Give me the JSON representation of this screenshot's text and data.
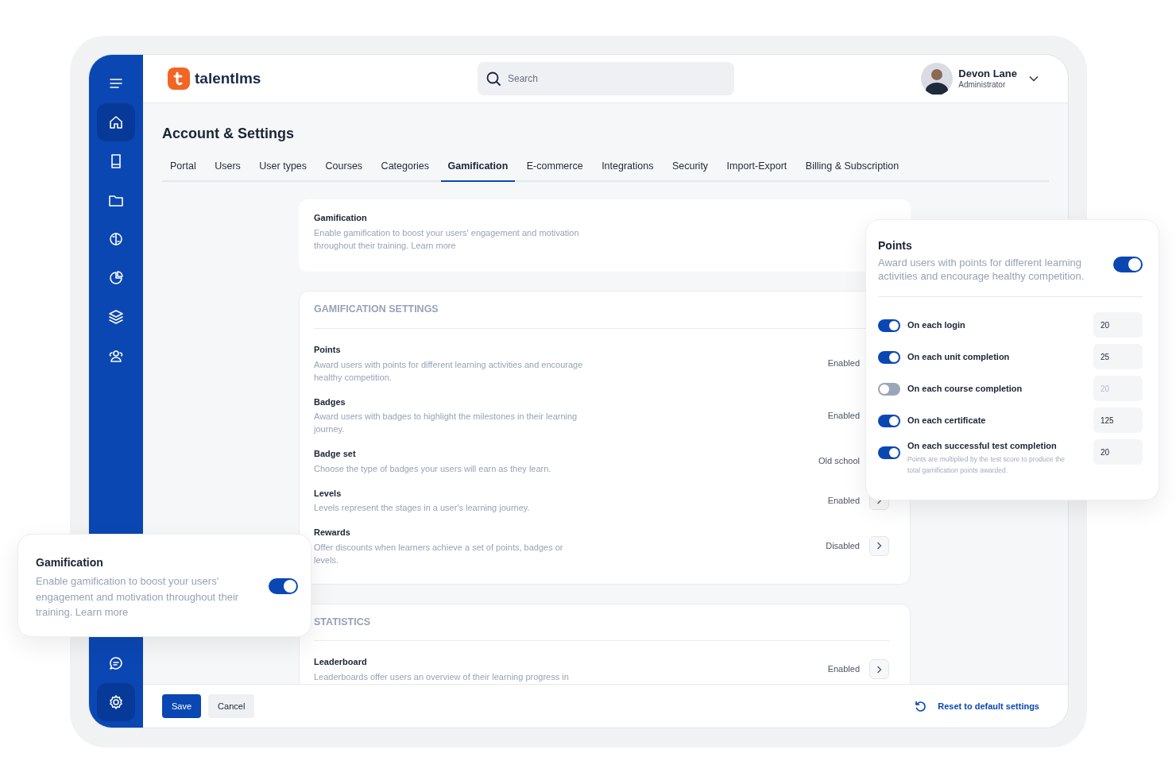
{
  "sidebar": {
    "items": [
      {
        "selected": false
      },
      {
        "selected": true
      },
      {
        "selected": false
      },
      {
        "selected": false
      },
      {
        "selected": false
      },
      {
        "selected": false
      },
      {
        "selected": false
      },
      {
        "selected": false
      }
    ],
    "bottom_items": [
      {
        "selected": false
      },
      {
        "selected": true
      }
    ]
  },
  "header": {
    "logo": "talentlms",
    "search": {
      "placeholder": "Search"
    },
    "user": {
      "name": "Devon Lane",
      "role": "Administrator"
    }
  },
  "page_title": "Account & Settings",
  "tabs": [
    {
      "label": "Portal",
      "selected": false
    },
    {
      "label": "Users",
      "selected": false
    },
    {
      "label": "User types",
      "selected": false
    },
    {
      "label": "Courses",
      "selected": false
    },
    {
      "label": "Categories",
      "selected": false
    },
    {
      "label": "Gamification",
      "selected": true
    },
    {
      "label": "E-commerce",
      "selected": false
    },
    {
      "label": "Integrations",
      "selected": false
    },
    {
      "label": "Security",
      "selected": false
    },
    {
      "label": "Import-Export",
      "selected": false
    },
    {
      "label": "Billing & Subscription",
      "selected": false
    }
  ],
  "intro_card": {
    "title": "Gamification",
    "description": "Enable gamification to boost your users' engagement and motivation throughout their training. Learn more"
  },
  "sections": [
    {
      "heading": "GAMIFICATION SETTINGS",
      "rows": [
        {
          "title": "Points",
          "description": "Award users with points for different learning activities and encourage healthy competition.",
          "status": "Enabled",
          "chevron": false
        },
        {
          "title": "Badges",
          "description": "Award users with badges to highlight the milestones in their learning journey.",
          "status": "Enabled",
          "chevron": false
        },
        {
          "title": "Badge set",
          "description": "Choose the type of badges your users will earn as they learn.",
          "status": "Old school",
          "chevron": false
        },
        {
          "title": "Levels",
          "description": "Levels represent the stages in a user's learning journey.",
          "status": "Enabled",
          "chevron": true
        },
        {
          "title": "Rewards",
          "description": "Offer discounts when learners achieve a set of points, badges or levels.",
          "status": "Disabled",
          "chevron": true
        }
      ]
    },
    {
      "heading": "STATISTICS",
      "rows": [
        {
          "title": "Leaderboard",
          "description": "Leaderboards offer users an overview of their learning progress in",
          "status": "Enabled",
          "chevron": true
        }
      ]
    }
  ],
  "footer": {
    "buttons": [
      "Save",
      "Cancel"
    ],
    "reset_link": "Reset to default settings"
  },
  "points_popup": {
    "title": "Points",
    "description": "Award users with points for different learning activities and encourage healthy competition.",
    "on": true,
    "items": [
      {
        "label": "On each login",
        "on": true,
        "value": "20"
      },
      {
        "label": "On each unit completion",
        "on": true,
        "value": "25"
      },
      {
        "label": "On each course completion",
        "on": false,
        "value": "20"
      },
      {
        "label": "On each certificate",
        "on": true,
        "value": "125"
      },
      {
        "label": "On each successful test completion",
        "note": "Points are multiplied by the test score to produce the total gamification points awarded.",
        "on": true,
        "value": "20"
      }
    ]
  },
  "gamification_popup": {
    "title": "Gamification",
    "description": "Enable gamification to boost your users' engagement and motivation throughout their training. Learn more",
    "on": true
  }
}
